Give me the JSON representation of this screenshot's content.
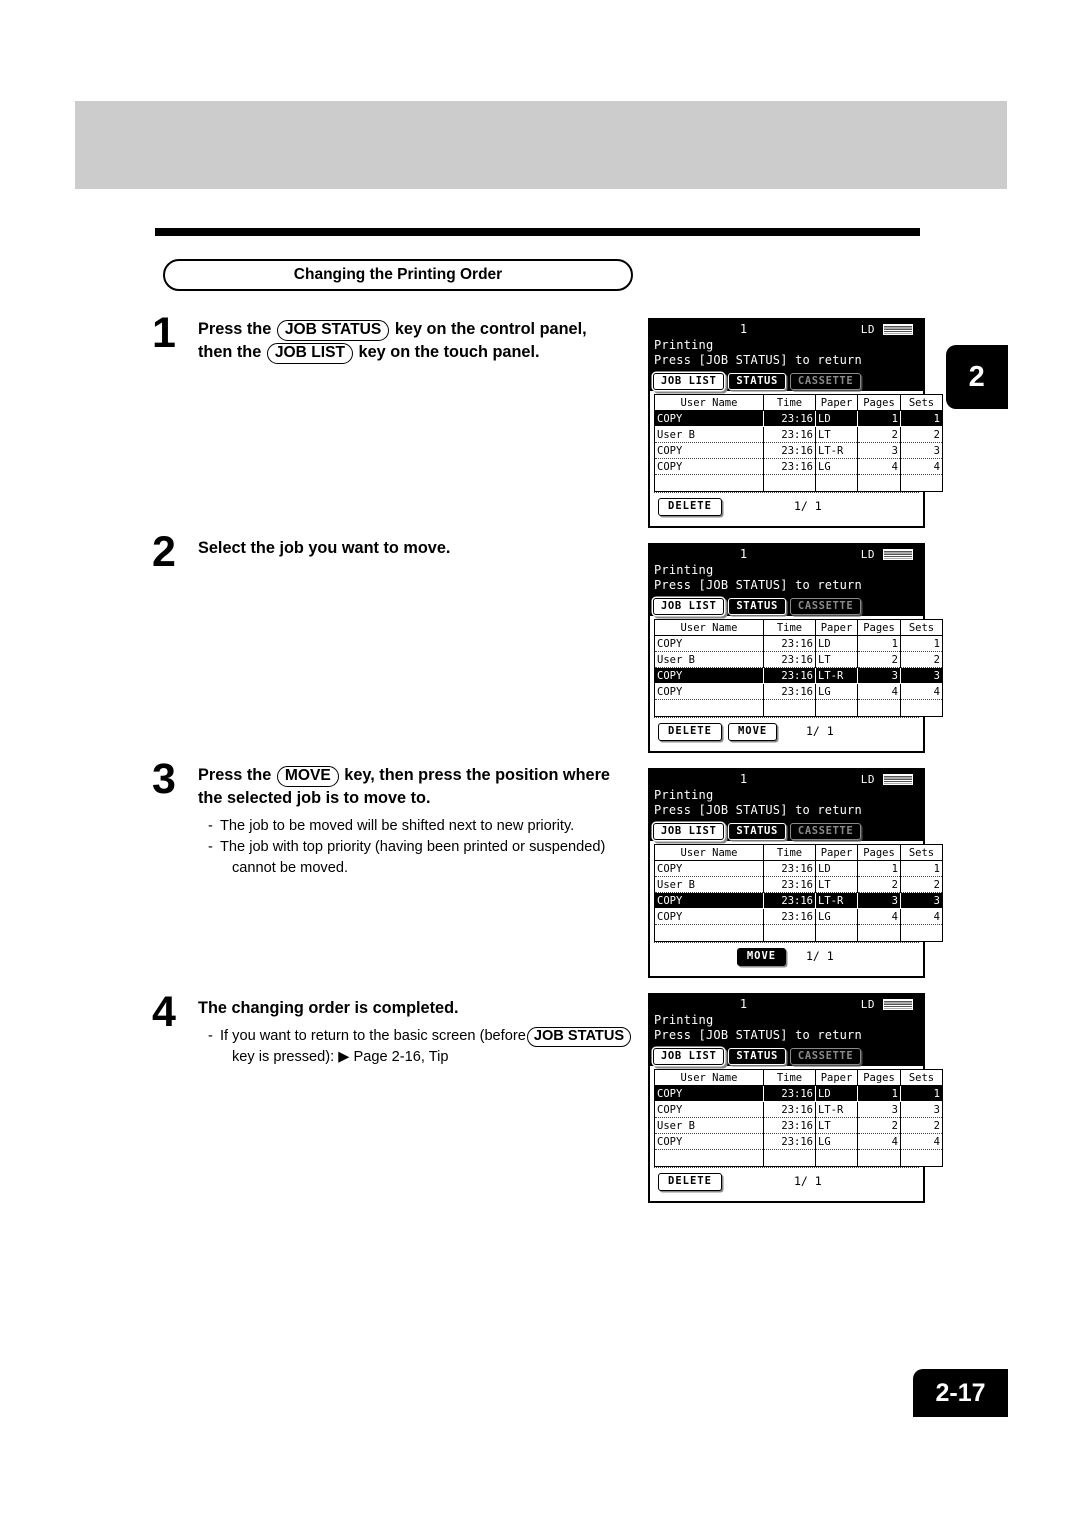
{
  "document": {
    "chapter_tab": "2",
    "page_number": "2-17",
    "section_title": "Changing the Printing Order"
  },
  "steps": [
    {
      "number": "1",
      "head_parts": [
        {
          "type": "text",
          "value": "Press the "
        },
        {
          "type": "key",
          "value": "JOB STATUS"
        },
        {
          "type": "text",
          "value": " key on the control panel,"
        },
        {
          "type": "break"
        },
        {
          "type": "text",
          "value": "then the "
        },
        {
          "type": "key",
          "value": "JOB LIST"
        },
        {
          "type": "text",
          "value": " key on the touch panel."
        }
      ],
      "notes": []
    },
    {
      "number": "2",
      "head_parts": [
        {
          "type": "text",
          "value": "Select the job you want to move."
        }
      ],
      "notes": []
    },
    {
      "number": "3",
      "head_parts": [
        {
          "type": "text",
          "value": "Press the "
        },
        {
          "type": "key",
          "value": "MOVE"
        },
        {
          "type": "text",
          "value": " key, then press the position where"
        },
        {
          "type": "break"
        },
        {
          "type": "text",
          "value": "the selected job is to move to."
        }
      ],
      "notes": [
        {
          "dash": "-",
          "text": "The job to be moved will be shifted next to new priority."
        },
        {
          "dash": "-",
          "text": "The job with top priority (having been printed or suspended)",
          "cont": "cannot be moved."
        }
      ]
    },
    {
      "number": "4",
      "head_parts": [
        {
          "type": "text",
          "value": "The changing order is completed."
        }
      ],
      "notes": [
        {
          "dash": "-",
          "pre": "If you want to return to the basic screen (before",
          "key": "JOB STATUS",
          "cont": "key is pressed): ▶ Page 2-16, Tip"
        }
      ]
    }
  ],
  "lcd_common": {
    "job_number": "1",
    "paper_size_label": "LD",
    "status_line1": "Printing",
    "status_line2": "Press [JOB STATUS] to return",
    "tabs": [
      {
        "label": "JOB LIST",
        "state": "selected"
      },
      {
        "label": "STATUS",
        "state": "normal"
      },
      {
        "label": "CASSETTE",
        "state": "disabled"
      }
    ],
    "columns": [
      "User Name",
      "Time",
      "Paper",
      "Pages",
      "Sets"
    ],
    "page_count": "1/ 1",
    "delete_label": "DELETE",
    "move_label": "MOVE"
  },
  "lcd_panels": [
    {
      "id": "panel-step-1",
      "rows": [
        {
          "user": "COPY",
          "time": "23:16",
          "paper": "LD",
          "pages": "1",
          "sets": "1",
          "selected": true
        },
        {
          "user": "User B",
          "time": "23:16",
          "paper": "LT",
          "pages": "2",
          "sets": "2",
          "selected": false
        },
        {
          "user": "COPY",
          "time": "23:16",
          "paper": "LT-R",
          "pages": "3",
          "sets": "3",
          "selected": false
        },
        {
          "user": "COPY",
          "time": "23:16",
          "paper": "LG",
          "pages": "4",
          "sets": "4",
          "selected": false
        }
      ],
      "buttons": [
        {
          "label": "DELETE",
          "state": "normal"
        }
      ],
      "buttons_centered": false
    },
    {
      "id": "panel-step-2",
      "rows": [
        {
          "user": "COPY",
          "time": "23:16",
          "paper": "LD",
          "pages": "1",
          "sets": "1",
          "selected": false
        },
        {
          "user": "User B",
          "time": "23:16",
          "paper": "LT",
          "pages": "2",
          "sets": "2",
          "selected": false
        },
        {
          "user": "COPY",
          "time": "23:16",
          "paper": "LT-R",
          "pages": "3",
          "sets": "3",
          "selected": true
        },
        {
          "user": "COPY",
          "time": "23:16",
          "paper": "LG",
          "pages": "4",
          "sets": "4",
          "selected": false
        }
      ],
      "buttons": [
        {
          "label": "DELETE",
          "state": "normal"
        },
        {
          "label": "MOVE",
          "state": "normal"
        }
      ],
      "buttons_centered": false
    },
    {
      "id": "panel-step-3",
      "rows": [
        {
          "user": "COPY",
          "time": "23:16",
          "paper": "LD",
          "pages": "1",
          "sets": "1",
          "selected": false
        },
        {
          "user": "User B",
          "time": "23:16",
          "paper": "LT",
          "pages": "2",
          "sets": "2",
          "selected": false
        },
        {
          "user": "COPY",
          "time": "23:16",
          "paper": "LT-R",
          "pages": "3",
          "sets": "3",
          "selected": true
        },
        {
          "user": "COPY",
          "time": "23:16",
          "paper": "LG",
          "pages": "4",
          "sets": "4",
          "selected": false
        }
      ],
      "buttons": [
        {
          "label": "MOVE",
          "state": "inverted"
        }
      ],
      "buttons_centered": true
    },
    {
      "id": "panel-step-4",
      "rows": [
        {
          "user": "COPY",
          "time": "23:16",
          "paper": "LD",
          "pages": "1",
          "sets": "1",
          "selected": true
        },
        {
          "user": "COPY",
          "time": "23:16",
          "paper": "LT-R",
          "pages": "3",
          "sets": "3",
          "selected": false
        },
        {
          "user": "User B",
          "time": "23:16",
          "paper": "LT",
          "pages": "2",
          "sets": "2",
          "selected": false
        },
        {
          "user": "COPY",
          "time": "23:16",
          "paper": "LG",
          "pages": "4",
          "sets": "4",
          "selected": false
        }
      ],
      "buttons": [
        {
          "label": "DELETE",
          "state": "normal"
        }
      ],
      "buttons_centered": false
    }
  ]
}
